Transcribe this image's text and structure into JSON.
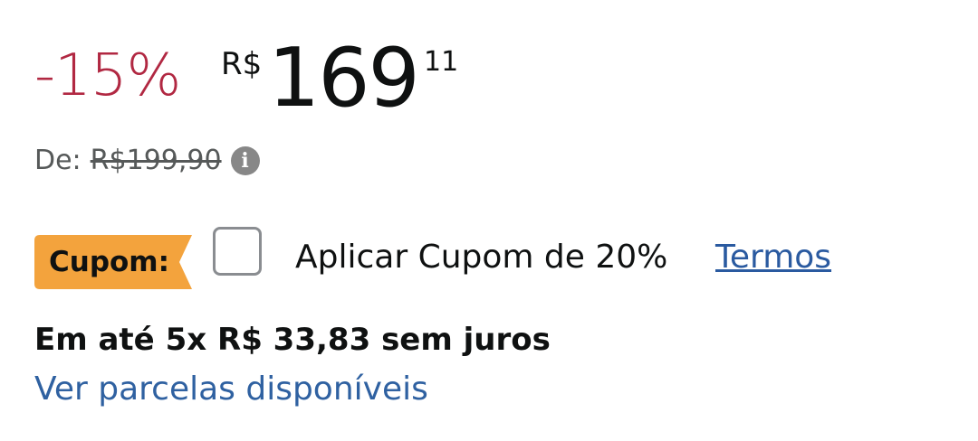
{
  "price": {
    "discount": "-15%",
    "currency": "R$",
    "whole": "169",
    "fraction": "11"
  },
  "list_price": {
    "label": "De:",
    "value": "R$199,90",
    "info_icon": "info-icon"
  },
  "coupon": {
    "badge_label": "Cupom:",
    "badge_color": "#f3a33d",
    "checked": false,
    "text": "Aplicar Cupom de 20%",
    "terms_label": "Termos"
  },
  "installments": {
    "text": "Em até 5x R$ 33,83 sem juros",
    "link_label": "Ver parcelas disponíveis"
  },
  "colors": {
    "discount": "#b12842",
    "link": "#2a5aa0",
    "muted": "#565959"
  }
}
